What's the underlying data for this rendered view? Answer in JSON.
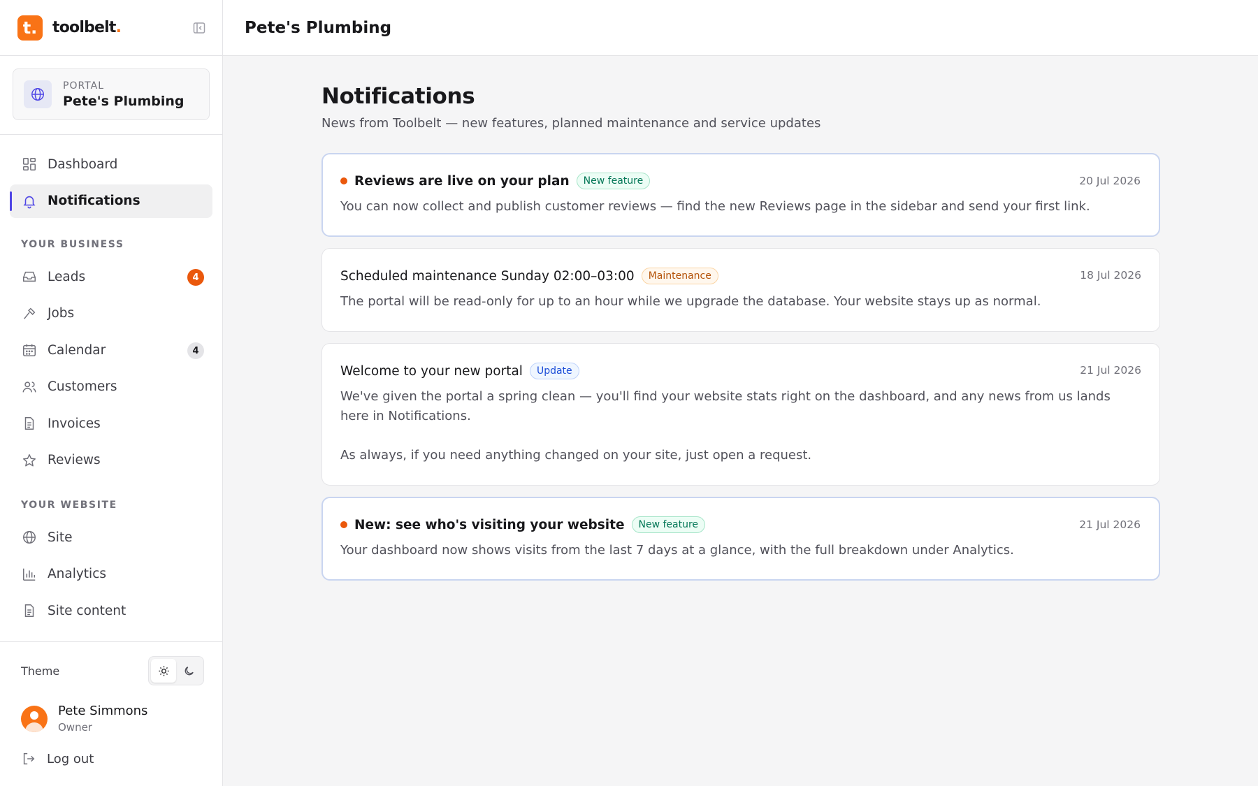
{
  "brand": {
    "logo_letter": "t.",
    "name": "toolbelt",
    "name_dot": "."
  },
  "portal": {
    "label": "PORTAL",
    "name": "Pete's Plumbing"
  },
  "nav": {
    "main": [
      {
        "label": "Dashboard",
        "icon": "dashboard-icon"
      },
      {
        "label": "Notifications",
        "icon": "bell-icon",
        "active": true
      }
    ],
    "business_title": "YOUR BUSINESS",
    "business": [
      {
        "label": "Leads",
        "icon": "inbox-icon",
        "badge": "4"
      },
      {
        "label": "Jobs",
        "icon": "hammer-icon"
      },
      {
        "label": "Calendar",
        "icon": "calendar-icon",
        "badge": "4"
      },
      {
        "label": "Customers",
        "icon": "users-icon"
      },
      {
        "label": "Invoices",
        "icon": "document-icon"
      },
      {
        "label": "Reviews",
        "icon": "star-icon"
      }
    ],
    "website_title": "YOUR WEBSITE",
    "website": [
      {
        "label": "Site",
        "icon": "globe-icon"
      },
      {
        "label": "Analytics",
        "icon": "bar-chart-icon"
      },
      {
        "label": "Site content",
        "icon": "document-icon"
      }
    ]
  },
  "theme": {
    "label": "Theme",
    "options": [
      "sun-icon",
      "moon-icon"
    ],
    "selected": "light"
  },
  "user": {
    "name": "Pete Simmons",
    "role": "Owner"
  },
  "logout": {
    "label": "Log out"
  },
  "header": {
    "title": "Pete's Plumbing"
  },
  "page": {
    "title": "Notifications",
    "subtitle": "News from Toolbelt — new features, planned maintenance and service updates"
  },
  "notifications": [
    {
      "title": "Reviews are live on your plan",
      "tag": "New feature",
      "date": "20 Jul 2026",
      "unread": true,
      "body": [
        "You can now collect and publish customer reviews — find the new Reviews page in the sidebar and send your first link."
      ]
    },
    {
      "title": "Scheduled maintenance Sunday 02:00–03:00",
      "tag": "Maintenance",
      "date": "18 Jul 2026",
      "unread": false,
      "body": [
        "The portal will be read-only for up to an hour while we upgrade the database. Your website stays up as normal."
      ]
    },
    {
      "title": "Welcome to your new portal",
      "tag": "Update",
      "date": "21 Jul 2026",
      "unread": false,
      "body": [
        "We've given the portal a spring clean — you'll find your website stats right on the dashboard, and any news from us lands here in Notifications.",
        "As always, if you need anything changed on your site, just open a request."
      ]
    },
    {
      "title": "New: see who's visiting your website",
      "tag": "New feature",
      "date": "21 Jul 2026",
      "unread": true,
      "body": [
        "Your dashboard now shows visits from the last 7 days at a glance, with the full breakdown under Analytics."
      ]
    }
  ],
  "colors": {
    "accent": "#f97316",
    "active_indicator": "#4f46e5",
    "unread_dot": "#ea580c"
  }
}
